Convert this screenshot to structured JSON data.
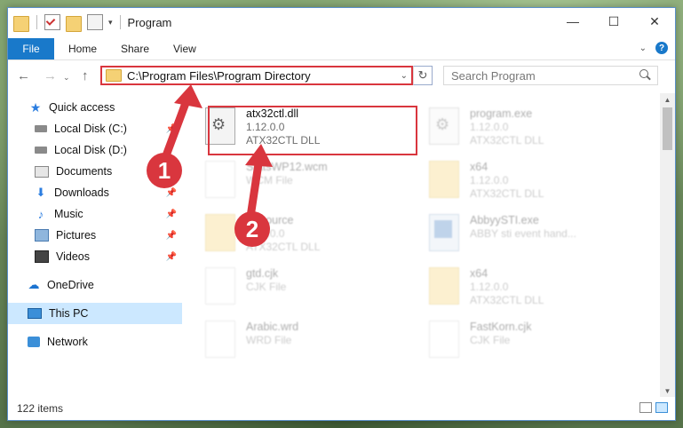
{
  "window": {
    "title": "Program",
    "controls": {
      "minimize": "—",
      "maximize": "☐",
      "close": "✕"
    }
  },
  "ribbon": {
    "tabs": [
      "File",
      "Home",
      "Share",
      "View"
    ],
    "help": "?"
  },
  "navigation": {
    "back": "←",
    "forward": "→",
    "up": "↑",
    "address": "C:\\Program Files\\Program Directory",
    "address_dropdown": "⌄",
    "refresh": "↻",
    "search_placeholder": "Search Program"
  },
  "sidebar": {
    "items": [
      {
        "label": "Quick access",
        "icon": "star-icon"
      },
      {
        "label": "Local Disk (C:)",
        "icon": "drive-icon",
        "pinned": true
      },
      {
        "label": "Local Disk (D:)",
        "icon": "drive-icon"
      },
      {
        "label": "Documents",
        "icon": "documents-icon",
        "pinned": true
      },
      {
        "label": "Downloads",
        "icon": "download-icon",
        "pinned": true
      },
      {
        "label": "Music",
        "icon": "music-icon",
        "pinned": true
      },
      {
        "label": "Pictures",
        "icon": "pictures-icon",
        "pinned": true
      },
      {
        "label": "Videos",
        "icon": "videos-icon",
        "pinned": true
      },
      {
        "label": "OneDrive",
        "icon": "cloud-icon"
      },
      {
        "label": "This PC",
        "icon": "computer-icon",
        "selected": true
      },
      {
        "label": "Network",
        "icon": "network-icon"
      }
    ]
  },
  "files": [
    {
      "name": "atx32ctl.dll",
      "line2": "1.12.0.0",
      "line3": "ATX32CTL DLL",
      "icon": "dll-icon",
      "highlighted": true
    },
    {
      "name": "program.exe",
      "line2": "1.12.0.0",
      "line3": "ATX32CTL DLL",
      "icon": "dll-icon"
    },
    {
      "name": "StatsWP12.wcm",
      "line2": "WCM File",
      "line3": "",
      "icon": "document-icon"
    },
    {
      "name": "x64",
      "line2": "1.12.0.0",
      "line3": "ATX32CTL DLL",
      "icon": "folder-icon"
    },
    {
      "name": "Resource",
      "line2": "1.12.0.0",
      "line3": "ATX32CTL DLL",
      "icon": "folder-icon"
    },
    {
      "name": "AbbyySTI.exe",
      "line2": "ABBY sti event hand...",
      "line3": "",
      "icon": "app-icon"
    },
    {
      "name": "gtd.cjk",
      "line2": "CJK File",
      "line3": "",
      "icon": "document-icon"
    },
    {
      "name": "x64",
      "line2": "1.12.0.0",
      "line3": "ATX32CTL DLL",
      "icon": "folder-icon"
    },
    {
      "name": "Arabic.wrd",
      "line2": "WRD File",
      "line3": "",
      "icon": "document-icon"
    },
    {
      "name": "FastKorn.cjk",
      "line2": "CJK File",
      "line3": "",
      "icon": "document-icon"
    }
  ],
  "status": {
    "item_count": "122 items"
  },
  "annotations": {
    "step1": "1",
    "step2": "2"
  },
  "colors": {
    "accent": "#1979ca",
    "highlight": "#d9363e",
    "selection": "#cce8ff"
  }
}
